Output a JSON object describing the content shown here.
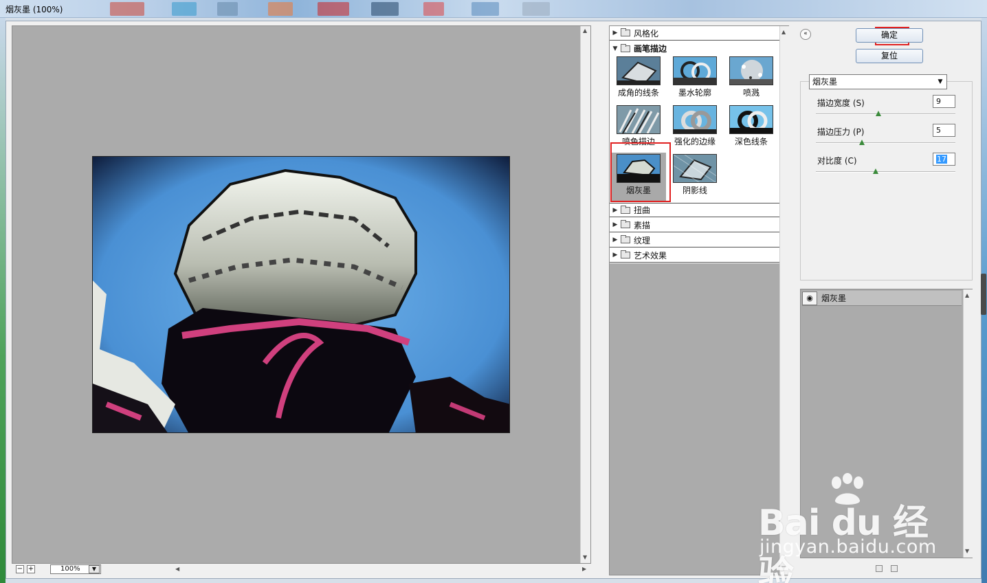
{
  "window": {
    "title": "烟灰墨 (100%)"
  },
  "preview": {
    "zoom": "100%",
    "zoom_minus": "−",
    "zoom_plus": "+"
  },
  "gallery": {
    "categories": [
      {
        "label": "风格化",
        "expanded": false
      },
      {
        "label": "画笔描边",
        "expanded": true
      },
      {
        "label": "扭曲",
        "expanded": false
      },
      {
        "label": "素描",
        "expanded": false
      },
      {
        "label": "纹理",
        "expanded": false
      },
      {
        "label": "艺术效果",
        "expanded": false
      }
    ],
    "filters": [
      {
        "label": "成角的线条"
      },
      {
        "label": "墨水轮廓"
      },
      {
        "label": "喷溅"
      },
      {
        "label": "喷色描边"
      },
      {
        "label": "强化的边缘"
      },
      {
        "label": "深色线条"
      },
      {
        "label": "烟灰墨",
        "selected": true
      },
      {
        "label": "阴影线"
      }
    ]
  },
  "actions": {
    "ok_label": "确定",
    "reset_label": "复位",
    "collapse_glyph": "«"
  },
  "settings": {
    "filter_name": "烟灰墨",
    "params": [
      {
        "label": "描边宽度 (S)",
        "value": "9",
        "level": 0.45
      },
      {
        "label": "描边压力 (P)",
        "value": "5",
        "level": 0.33
      },
      {
        "label": "对比度 (C)",
        "value": "17",
        "level": 0.43
      }
    ]
  },
  "layers": {
    "items": [
      {
        "label": "烟灰墨"
      }
    ]
  },
  "watermark": {
    "brand": "Bai du 经验",
    "url": "jingyan.baidu.com"
  },
  "colors": {
    "highlight": "#e02020",
    "panel_gray": "#ababab",
    "accent_blue": "#3399ff"
  }
}
